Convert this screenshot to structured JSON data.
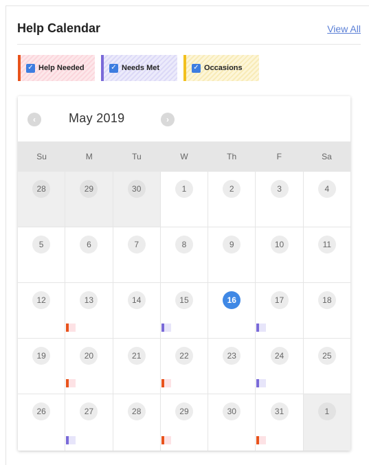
{
  "header": {
    "title": "Help Calendar",
    "view_all": "View All"
  },
  "filters": [
    {
      "label": "Help Needed",
      "checked": true,
      "color": "#e8531c"
    },
    {
      "label": "Needs Met",
      "checked": true,
      "color": "#7a6ad8"
    },
    {
      "label": "Occasions",
      "checked": true,
      "color": "#f2c01e"
    }
  ],
  "calendar": {
    "month_label": "May 2019",
    "prev_icon": "chevron-left-icon",
    "next_icon": "chevron-right-icon",
    "accent": "#3f88e5",
    "weekdays": [
      "Su",
      "M",
      "Tu",
      "W",
      "Th",
      "F",
      "Sa"
    ],
    "weeks": [
      [
        {
          "day": "28",
          "muted": true
        },
        {
          "day": "29",
          "muted": true
        },
        {
          "day": "30",
          "muted": true
        },
        {
          "day": "1"
        },
        {
          "day": "2"
        },
        {
          "day": "3"
        },
        {
          "day": "4"
        }
      ],
      [
        {
          "day": "5"
        },
        {
          "day": "6"
        },
        {
          "day": "7"
        },
        {
          "day": "8"
        },
        {
          "day": "9"
        },
        {
          "day": "10"
        },
        {
          "day": "11"
        }
      ],
      [
        {
          "day": "12"
        },
        {
          "day": "13",
          "marker": "help"
        },
        {
          "day": "14"
        },
        {
          "day": "15",
          "marker": "met"
        },
        {
          "day": "16",
          "today": true
        },
        {
          "day": "17",
          "marker": "met"
        },
        {
          "day": "18"
        }
      ],
      [
        {
          "day": "19"
        },
        {
          "day": "20",
          "marker": "help"
        },
        {
          "day": "21"
        },
        {
          "day": "22",
          "marker": "help"
        },
        {
          "day": "23"
        },
        {
          "day": "24",
          "marker": "met"
        },
        {
          "day": "25"
        }
      ],
      [
        {
          "day": "26"
        },
        {
          "day": "27",
          "marker": "met"
        },
        {
          "day": "28"
        },
        {
          "day": "29",
          "marker": "help"
        },
        {
          "day": "30"
        },
        {
          "day": "31",
          "marker": "help"
        },
        {
          "day": "1",
          "muted": true
        }
      ]
    ]
  }
}
